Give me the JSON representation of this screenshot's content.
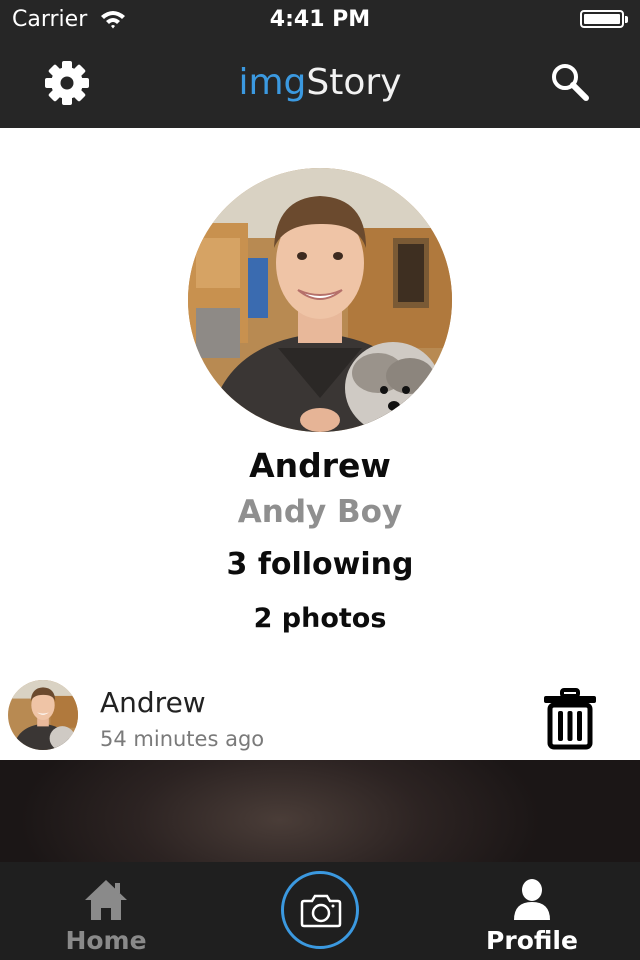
{
  "status_bar": {
    "carrier": "Carrier",
    "time": "4:41 PM",
    "icons": [
      "wifi-icon",
      "battery-icon"
    ]
  },
  "nav_bar": {
    "title_part1": "img",
    "title_part2": "Story",
    "icons": [
      "gear-icon",
      "search-icon"
    ]
  },
  "profile": {
    "name": "Andrew",
    "username": "Andy Boy",
    "following": "3 following",
    "photos": "2 photos"
  },
  "post": {
    "author": "Andrew",
    "time": "54 minutes ago",
    "icons": [
      "trash-icon"
    ]
  },
  "tab_bar": {
    "home_label": "Home",
    "profile_label": "Profile",
    "active_tab": "Profile",
    "icons": [
      "home-icon",
      "camera-icon",
      "person-icon"
    ]
  },
  "colors": {
    "accent": "#3b99e0",
    "bar_background": "#262626",
    "tab_background": "#1f1f1f",
    "inactive_tab": "#8a8a8a",
    "secondary_text": "#8f8f8f"
  }
}
